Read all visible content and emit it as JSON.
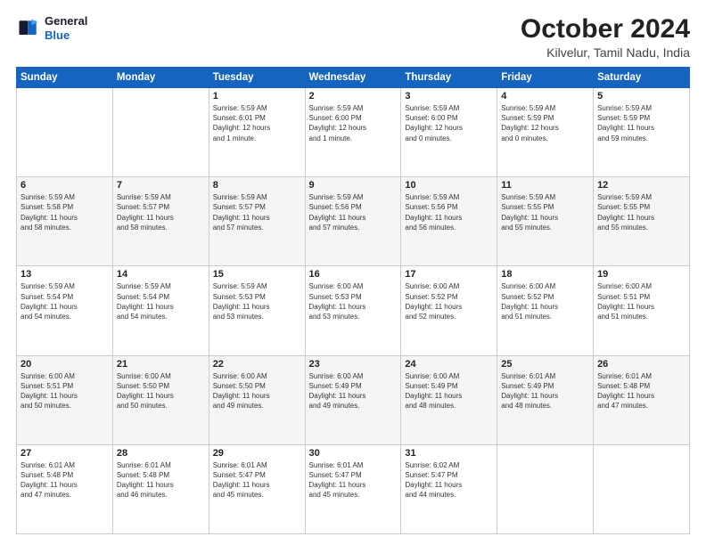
{
  "logo": {
    "line1": "General",
    "line2": "Blue"
  },
  "title": "October 2024",
  "location": "Kilvelur, Tamil Nadu, India",
  "weekdays": [
    "Sunday",
    "Monday",
    "Tuesday",
    "Wednesday",
    "Thursday",
    "Friday",
    "Saturday"
  ],
  "weeks": [
    [
      {
        "day": "",
        "text": ""
      },
      {
        "day": "",
        "text": ""
      },
      {
        "day": "1",
        "text": "Sunrise: 5:59 AM\nSunset: 6:01 PM\nDaylight: 12 hours\nand 1 minute."
      },
      {
        "day": "2",
        "text": "Sunrise: 5:59 AM\nSunset: 6:00 PM\nDaylight: 12 hours\nand 1 minute."
      },
      {
        "day": "3",
        "text": "Sunrise: 5:59 AM\nSunset: 6:00 PM\nDaylight: 12 hours\nand 0 minutes."
      },
      {
        "day": "4",
        "text": "Sunrise: 5:59 AM\nSunset: 5:59 PM\nDaylight: 12 hours\nand 0 minutes."
      },
      {
        "day": "5",
        "text": "Sunrise: 5:59 AM\nSunset: 5:59 PM\nDaylight: 11 hours\nand 59 minutes."
      }
    ],
    [
      {
        "day": "6",
        "text": "Sunrise: 5:59 AM\nSunset: 5:58 PM\nDaylight: 11 hours\nand 58 minutes."
      },
      {
        "day": "7",
        "text": "Sunrise: 5:59 AM\nSunset: 5:57 PM\nDaylight: 11 hours\nand 58 minutes."
      },
      {
        "day": "8",
        "text": "Sunrise: 5:59 AM\nSunset: 5:57 PM\nDaylight: 11 hours\nand 57 minutes."
      },
      {
        "day": "9",
        "text": "Sunrise: 5:59 AM\nSunset: 5:56 PM\nDaylight: 11 hours\nand 57 minutes."
      },
      {
        "day": "10",
        "text": "Sunrise: 5:59 AM\nSunset: 5:56 PM\nDaylight: 11 hours\nand 56 minutes."
      },
      {
        "day": "11",
        "text": "Sunrise: 5:59 AM\nSunset: 5:55 PM\nDaylight: 11 hours\nand 55 minutes."
      },
      {
        "day": "12",
        "text": "Sunrise: 5:59 AM\nSunset: 5:55 PM\nDaylight: 11 hours\nand 55 minutes."
      }
    ],
    [
      {
        "day": "13",
        "text": "Sunrise: 5:59 AM\nSunset: 5:54 PM\nDaylight: 11 hours\nand 54 minutes."
      },
      {
        "day": "14",
        "text": "Sunrise: 5:59 AM\nSunset: 5:54 PM\nDaylight: 11 hours\nand 54 minutes."
      },
      {
        "day": "15",
        "text": "Sunrise: 5:59 AM\nSunset: 5:53 PM\nDaylight: 11 hours\nand 53 minutes."
      },
      {
        "day": "16",
        "text": "Sunrise: 6:00 AM\nSunset: 5:53 PM\nDaylight: 11 hours\nand 53 minutes."
      },
      {
        "day": "17",
        "text": "Sunrise: 6:00 AM\nSunset: 5:52 PM\nDaylight: 11 hours\nand 52 minutes."
      },
      {
        "day": "18",
        "text": "Sunrise: 6:00 AM\nSunset: 5:52 PM\nDaylight: 11 hours\nand 51 minutes."
      },
      {
        "day": "19",
        "text": "Sunrise: 6:00 AM\nSunset: 5:51 PM\nDaylight: 11 hours\nand 51 minutes."
      }
    ],
    [
      {
        "day": "20",
        "text": "Sunrise: 6:00 AM\nSunset: 5:51 PM\nDaylight: 11 hours\nand 50 minutes."
      },
      {
        "day": "21",
        "text": "Sunrise: 6:00 AM\nSunset: 5:50 PM\nDaylight: 11 hours\nand 50 minutes."
      },
      {
        "day": "22",
        "text": "Sunrise: 6:00 AM\nSunset: 5:50 PM\nDaylight: 11 hours\nand 49 minutes."
      },
      {
        "day": "23",
        "text": "Sunrise: 6:00 AM\nSunset: 5:49 PM\nDaylight: 11 hours\nand 49 minutes."
      },
      {
        "day": "24",
        "text": "Sunrise: 6:00 AM\nSunset: 5:49 PM\nDaylight: 11 hours\nand 48 minutes."
      },
      {
        "day": "25",
        "text": "Sunrise: 6:01 AM\nSunset: 5:49 PM\nDaylight: 11 hours\nand 48 minutes."
      },
      {
        "day": "26",
        "text": "Sunrise: 6:01 AM\nSunset: 5:48 PM\nDaylight: 11 hours\nand 47 minutes."
      }
    ],
    [
      {
        "day": "27",
        "text": "Sunrise: 6:01 AM\nSunset: 5:48 PM\nDaylight: 11 hours\nand 47 minutes."
      },
      {
        "day": "28",
        "text": "Sunrise: 6:01 AM\nSunset: 5:48 PM\nDaylight: 11 hours\nand 46 minutes."
      },
      {
        "day": "29",
        "text": "Sunrise: 6:01 AM\nSunset: 5:47 PM\nDaylight: 11 hours\nand 45 minutes."
      },
      {
        "day": "30",
        "text": "Sunrise: 6:01 AM\nSunset: 5:47 PM\nDaylight: 11 hours\nand 45 minutes."
      },
      {
        "day": "31",
        "text": "Sunrise: 6:02 AM\nSunset: 5:47 PM\nDaylight: 11 hours\nand 44 minutes."
      },
      {
        "day": "",
        "text": ""
      },
      {
        "day": "",
        "text": ""
      }
    ]
  ]
}
